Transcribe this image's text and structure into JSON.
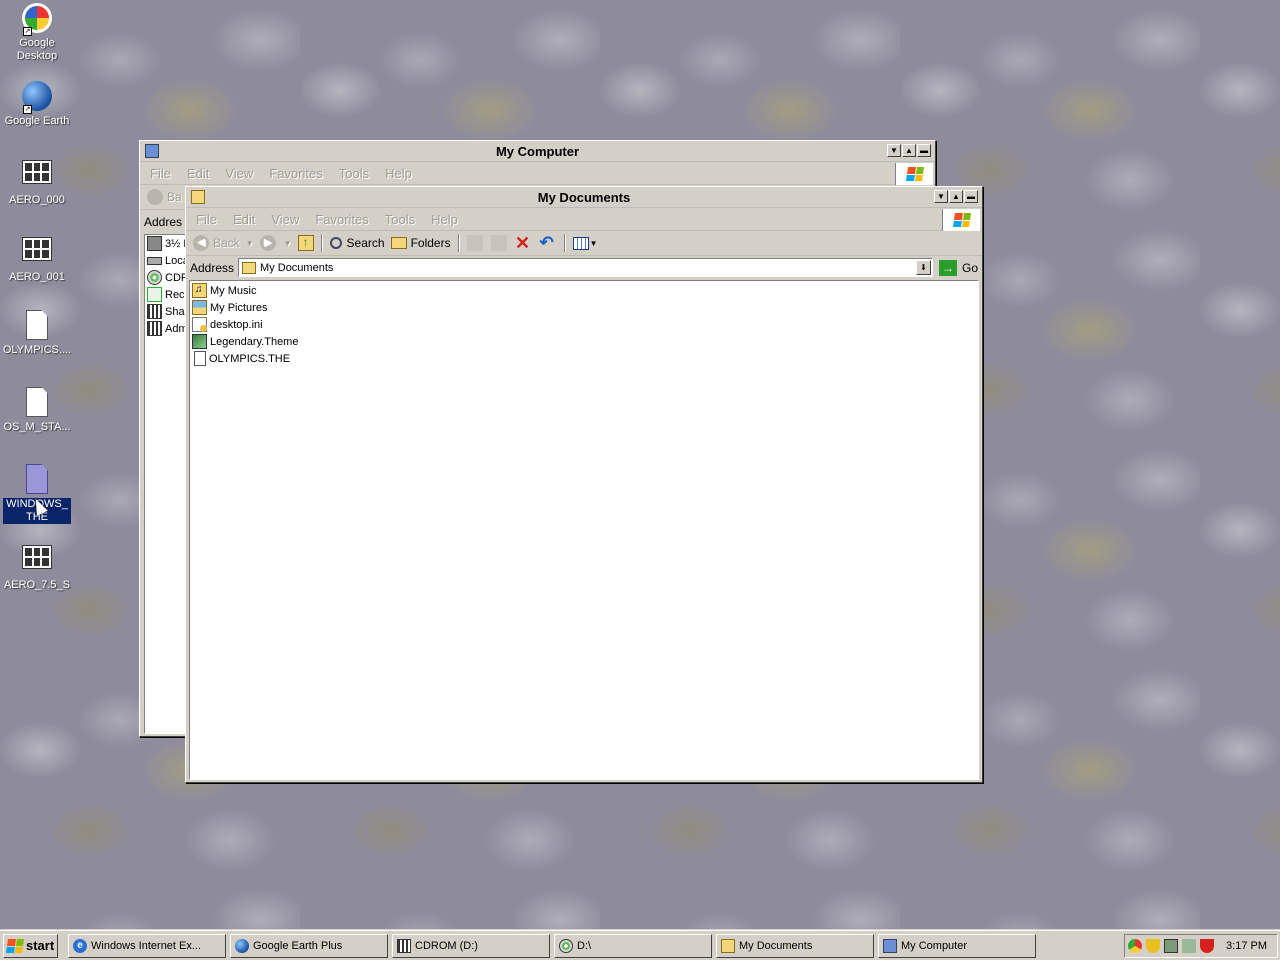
{
  "desktop": {
    "icons": [
      {
        "label": "Google Desktop",
        "icon": "google-desktop-icon"
      },
      {
        "label": "Google Earth",
        "icon": "google-earth-icon"
      },
      {
        "label": "AERO_000",
        "icon": "theme-file-icon"
      },
      {
        "label": "AERO_001",
        "icon": "theme-file-icon"
      },
      {
        "label": "OLYMPICS....",
        "icon": "blank-document-icon"
      },
      {
        "label": "OS_M_STA...",
        "icon": "blank-document-icon"
      },
      {
        "label": "WINDOWS_THE",
        "icon": "theme-document-icon"
      },
      {
        "label": "AERO_7.5_S",
        "icon": "theme-file-icon"
      }
    ]
  },
  "my_computer": {
    "title": "My Computer",
    "menu": [
      "File",
      "Edit",
      "View",
      "Favorites",
      "Tools",
      "Help"
    ],
    "back_label": "Ba",
    "address_label": "Addres",
    "items": [
      "3½ F",
      "Loca",
      "CDF",
      "Rec",
      "Shar",
      "Adm"
    ]
  },
  "my_documents": {
    "title": "My Documents",
    "menu": [
      "File",
      "Edit",
      "View",
      "Favorites",
      "Tools",
      "Help"
    ],
    "toolbar": {
      "back": "Back",
      "search": "Search",
      "folders": "Folders"
    },
    "address_label": "Address",
    "address_value": "My Documents",
    "go_label": "Go",
    "files": [
      {
        "name": "My Music",
        "icon": "music-folder-icon"
      },
      {
        "name": "My Pictures",
        "icon": "pictures-folder-icon"
      },
      {
        "name": "desktop.ini",
        "icon": "ini-file-icon"
      },
      {
        "name": "Legendary.Theme",
        "icon": "theme-file-icon"
      },
      {
        "name": "OLYMPICS.THE",
        "icon": "blank-document-icon"
      }
    ]
  },
  "taskbar": {
    "start_label": "start",
    "tasks": [
      {
        "label": "Windows Internet Ex...",
        "icon": "ie-icon"
      },
      {
        "label": "Google Earth Plus",
        "icon": "google-earth-icon"
      },
      {
        "label": "CDROM (D:)",
        "icon": "cdrom-icon"
      },
      {
        "label": "D:\\",
        "icon": "cd-drive-icon"
      },
      {
        "label": "My Documents",
        "icon": "folder-icon"
      },
      {
        "label": "My Computer",
        "icon": "computer-icon"
      }
    ],
    "clock": "3:17 PM",
    "tray_icons": [
      "chrome-icon",
      "shield-icon",
      "network-icon",
      "speaker-icon",
      "security-alert-icon"
    ]
  },
  "colors": {
    "selection": "#0a246a",
    "window_face": "#d4d0c8",
    "disabled_text": "#a09c94"
  }
}
